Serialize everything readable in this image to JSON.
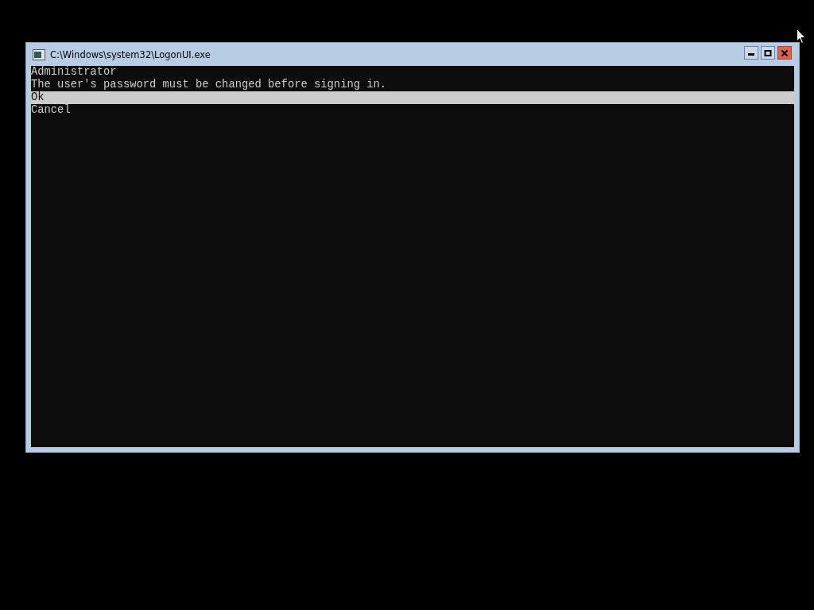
{
  "window": {
    "title": "C:\\Windows\\system32\\LogonUI.exe"
  },
  "console": {
    "lines": [
      "Administrator",
      "The user's password must be changed before signing in."
    ],
    "options": [
      {
        "label": "Ok",
        "selected": true
      },
      {
        "label": "Cancel",
        "selected": false
      }
    ]
  }
}
